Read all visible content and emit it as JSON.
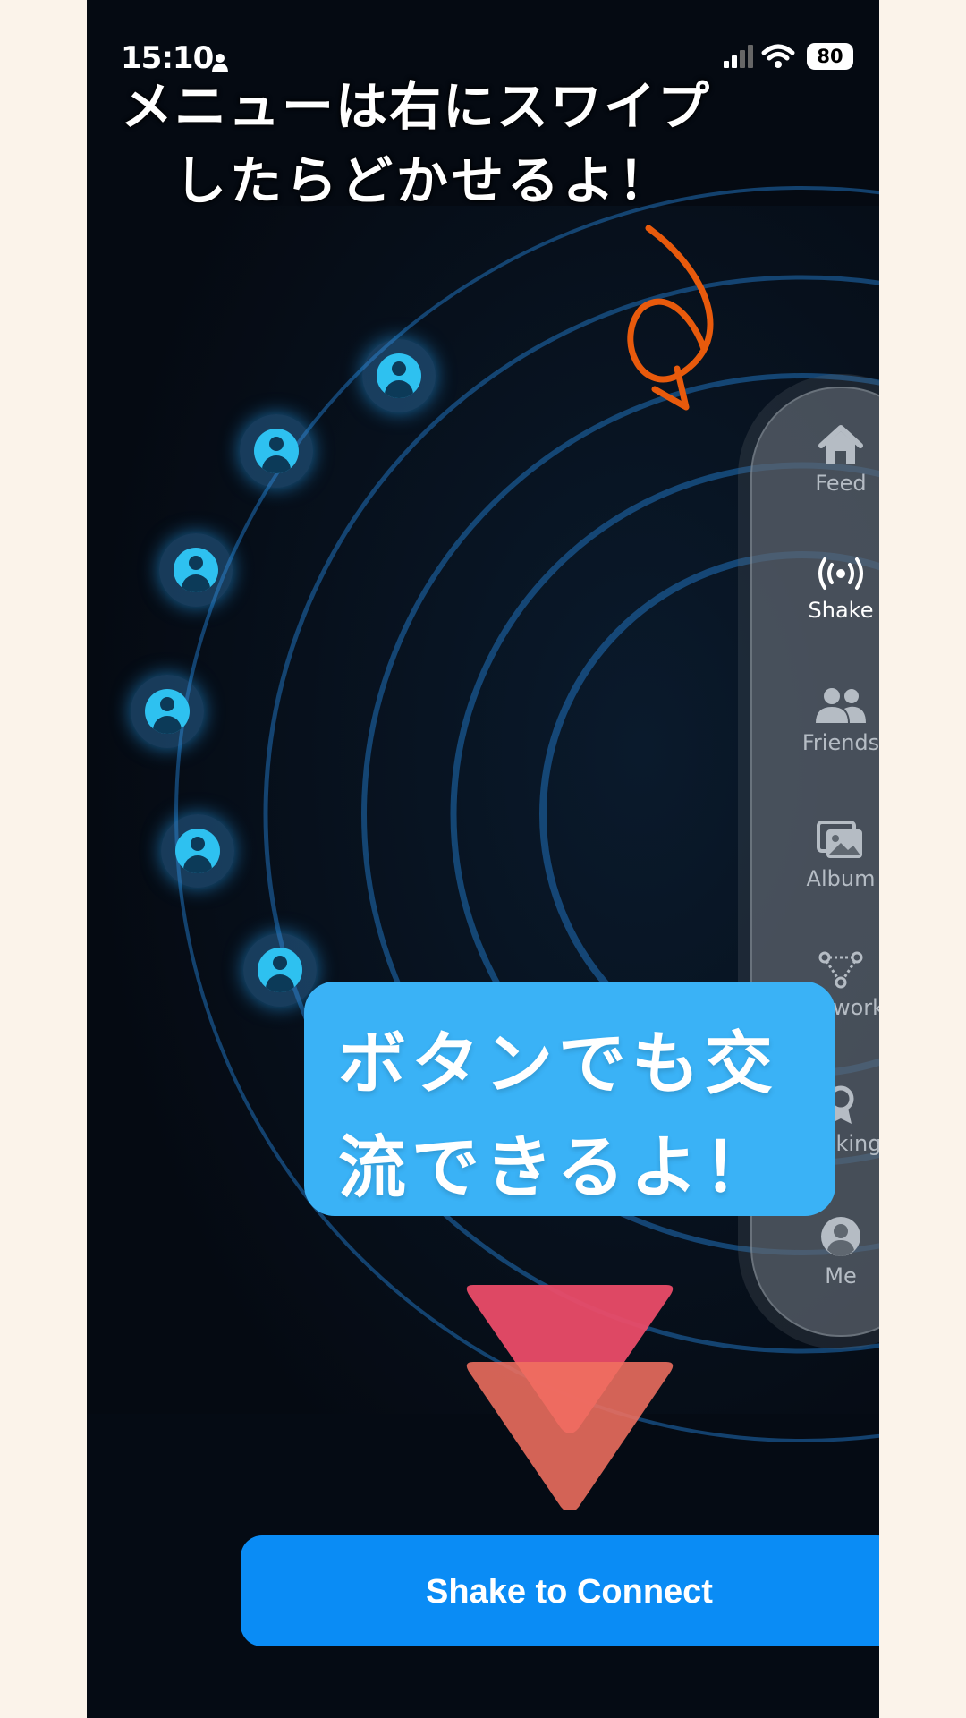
{
  "status_bar": {
    "time": "15:10",
    "battery": "80"
  },
  "annotation": {
    "line1": "メニューは右にスワイプ",
    "line2": "したらどかせるよ！",
    "color": "#e85a0c"
  },
  "side_menu": {
    "items": [
      {
        "label": "Feed",
        "icon": "house-icon",
        "active": false
      },
      {
        "label": "Shake",
        "icon": "broadcast-icon",
        "active": true
      },
      {
        "label": "Friends",
        "icon": "people-icon",
        "active": false
      },
      {
        "label": "Album",
        "icon": "photos-icon",
        "active": false
      },
      {
        "label": "work",
        "icon": "network-icon",
        "active": false
      },
      {
        "label": "king",
        "icon": "ranking-icon",
        "active": false
      },
      {
        "label": "Me",
        "icon": "person-circle-icon",
        "active": false
      }
    ]
  },
  "callout": {
    "line1": "ボタンでも交",
    "line2": "流できるよ！",
    "color": "#3ab2f6"
  },
  "main": {
    "connect_button": "Shake to Connect",
    "accent": "#0a8cf5"
  }
}
